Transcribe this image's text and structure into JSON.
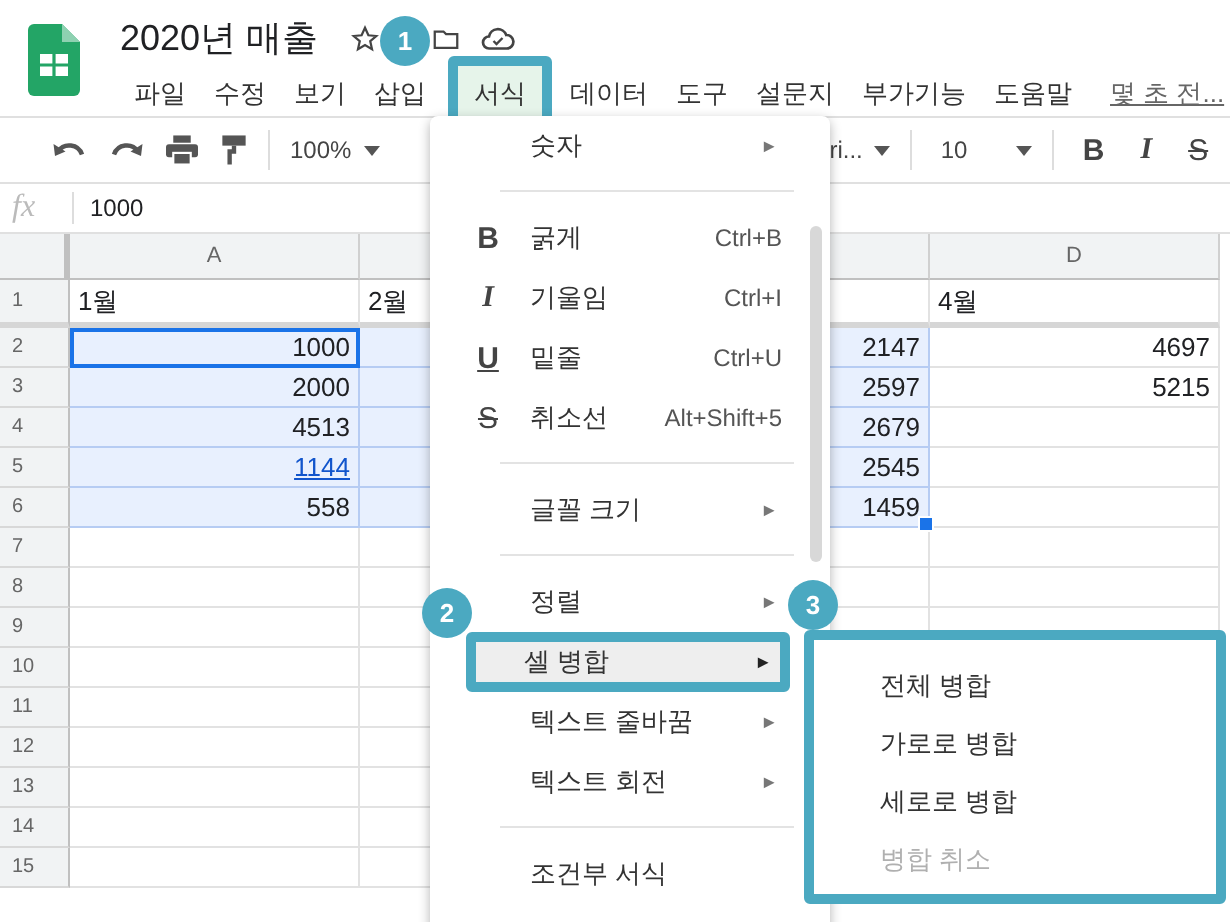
{
  "title": "2020년 매출",
  "menubar": [
    {
      "label": "파일",
      "selected": false
    },
    {
      "label": "수정",
      "selected": false
    },
    {
      "label": "보기",
      "selected": false
    },
    {
      "label": "삽입",
      "selected": false
    },
    {
      "label": "서식",
      "selected": true
    },
    {
      "label": "데이터",
      "selected": false
    },
    {
      "label": "도구",
      "selected": false
    },
    {
      "label": "설문지",
      "selected": false
    },
    {
      "label": "부가기능",
      "selected": false
    },
    {
      "label": "도움말",
      "selected": false
    }
  ],
  "last_edit": "몇 초 전...",
  "toolbar": {
    "zoom": "100%",
    "font": "ri...",
    "size": "10",
    "format_buttons": [
      {
        "char": "B",
        "kind": "bold"
      },
      {
        "char": "I",
        "kind": "italic"
      },
      {
        "char": "S",
        "kind": "strike"
      }
    ]
  },
  "formula": {
    "label": "fx",
    "value": "1000"
  },
  "columns": [
    "A",
    null,
    null,
    "D"
  ],
  "rows": [
    {
      "num": "1",
      "cells": [
        {
          "text": "1월",
          "selected": false
        },
        {
          "text": "2월",
          "selected": false
        },
        null,
        {
          "text": "4월",
          "selected": false
        }
      ]
    },
    {
      "num": "2",
      "cells": [
        {
          "text": "1000",
          "selected": true,
          "active": true
        },
        {
          "selected": true
        },
        {
          "text": "2147",
          "selected": true
        },
        {
          "text": "4697",
          "selected": false
        }
      ]
    },
    {
      "num": "3",
      "cells": [
        {
          "text": "2000",
          "selected": true
        },
        {
          "selected": true
        },
        {
          "text": "2597",
          "selected": true
        },
        {
          "text": "5215",
          "selected": false
        }
      ]
    },
    {
      "num": "4",
      "cells": [
        {
          "text": "4513",
          "selected": true
        },
        {
          "selected": true
        },
        {
          "text": "2679",
          "selected": true
        },
        null
      ]
    },
    {
      "num": "5",
      "cells": [
        {
          "text": "1144",
          "selected": true,
          "kind": "link"
        },
        {
          "selected": true
        },
        {
          "text": "2545",
          "selected": true
        },
        null
      ]
    },
    {
      "num": "6",
      "cells": [
        {
          "text": "558",
          "selected": true
        },
        {
          "selected": true
        },
        {
          "text": "1459",
          "selected": true,
          "fill_handle": true
        },
        null
      ]
    },
    {
      "num": "7",
      "cells": [
        null,
        null,
        null,
        null
      ]
    },
    {
      "num": "8",
      "cells": [
        null,
        null,
        null,
        null
      ]
    },
    {
      "num": "9",
      "cells": [
        null,
        null
      ]
    },
    {
      "num": "10",
      "cells": [
        null,
        null
      ]
    },
    {
      "num": "11",
      "cells": [
        null,
        null,
        null,
        null
      ]
    },
    {
      "num": "12",
      "cells": [
        null,
        null,
        null,
        null
      ]
    },
    {
      "num": "13",
      "cells": [
        null,
        null,
        null,
        null
      ]
    },
    {
      "num": "14",
      "cells": [
        null,
        null,
        null,
        null
      ]
    },
    {
      "num": "15",
      "cells": [
        null,
        null,
        null,
        null
      ]
    }
  ],
  "format_menu": [
    {
      "kind": "item",
      "label": "숫자",
      "arrow": "►",
      "selected": false
    },
    {
      "kind": "separator"
    },
    {
      "kind": "item",
      "glyph": {
        "char": "B",
        "kind": "bold"
      },
      "label": "굵게",
      "shortcut": "Ctrl+B",
      "selected": false
    },
    {
      "kind": "item",
      "glyph": {
        "char": "I",
        "kind": "italic"
      },
      "label": "기울임",
      "shortcut": "Ctrl+I",
      "selected": false
    },
    {
      "kind": "item",
      "glyph": {
        "char": "U",
        "kind": "underline"
      },
      "label": "밑줄",
      "shortcut": "Ctrl+U",
      "selected": false
    },
    {
      "kind": "item",
      "glyph": {
        "char": "S",
        "kind": "strike"
      },
      "label": "취소선",
      "shortcut": "Alt+Shift+5",
      "selected": false
    },
    {
      "kind": "separator"
    },
    {
      "kind": "item",
      "label": "글꼴 크기",
      "arrow": "►",
      "selected": false
    },
    {
      "kind": "separator"
    },
    {
      "kind": "item",
      "label": "정렬",
      "arrow": "►",
      "selected": false
    },
    {
      "kind": "item",
      "label": "셀 병합",
      "arrow": "►",
      "selected": true
    },
    {
      "kind": "item",
      "label": "텍스트 줄바꿈",
      "arrow": "►",
      "selected": false
    },
    {
      "kind": "item",
      "label": "텍스트 회전",
      "arrow": "►",
      "selected": false
    },
    {
      "kind": "separator"
    },
    {
      "kind": "item",
      "label": "조건부 서식",
      "selected": false
    }
  ],
  "merge_submenu": [
    {
      "label": "전체 병합",
      "disabled": false
    },
    {
      "label": "가로로 병합",
      "disabled": false
    },
    {
      "label": "세로로 병합",
      "disabled": false
    },
    {
      "label": "병합 취소",
      "disabled": true
    }
  ],
  "callouts": [
    {
      "number": "1"
    },
    {
      "number": "2"
    },
    {
      "number": "3"
    }
  ]
}
